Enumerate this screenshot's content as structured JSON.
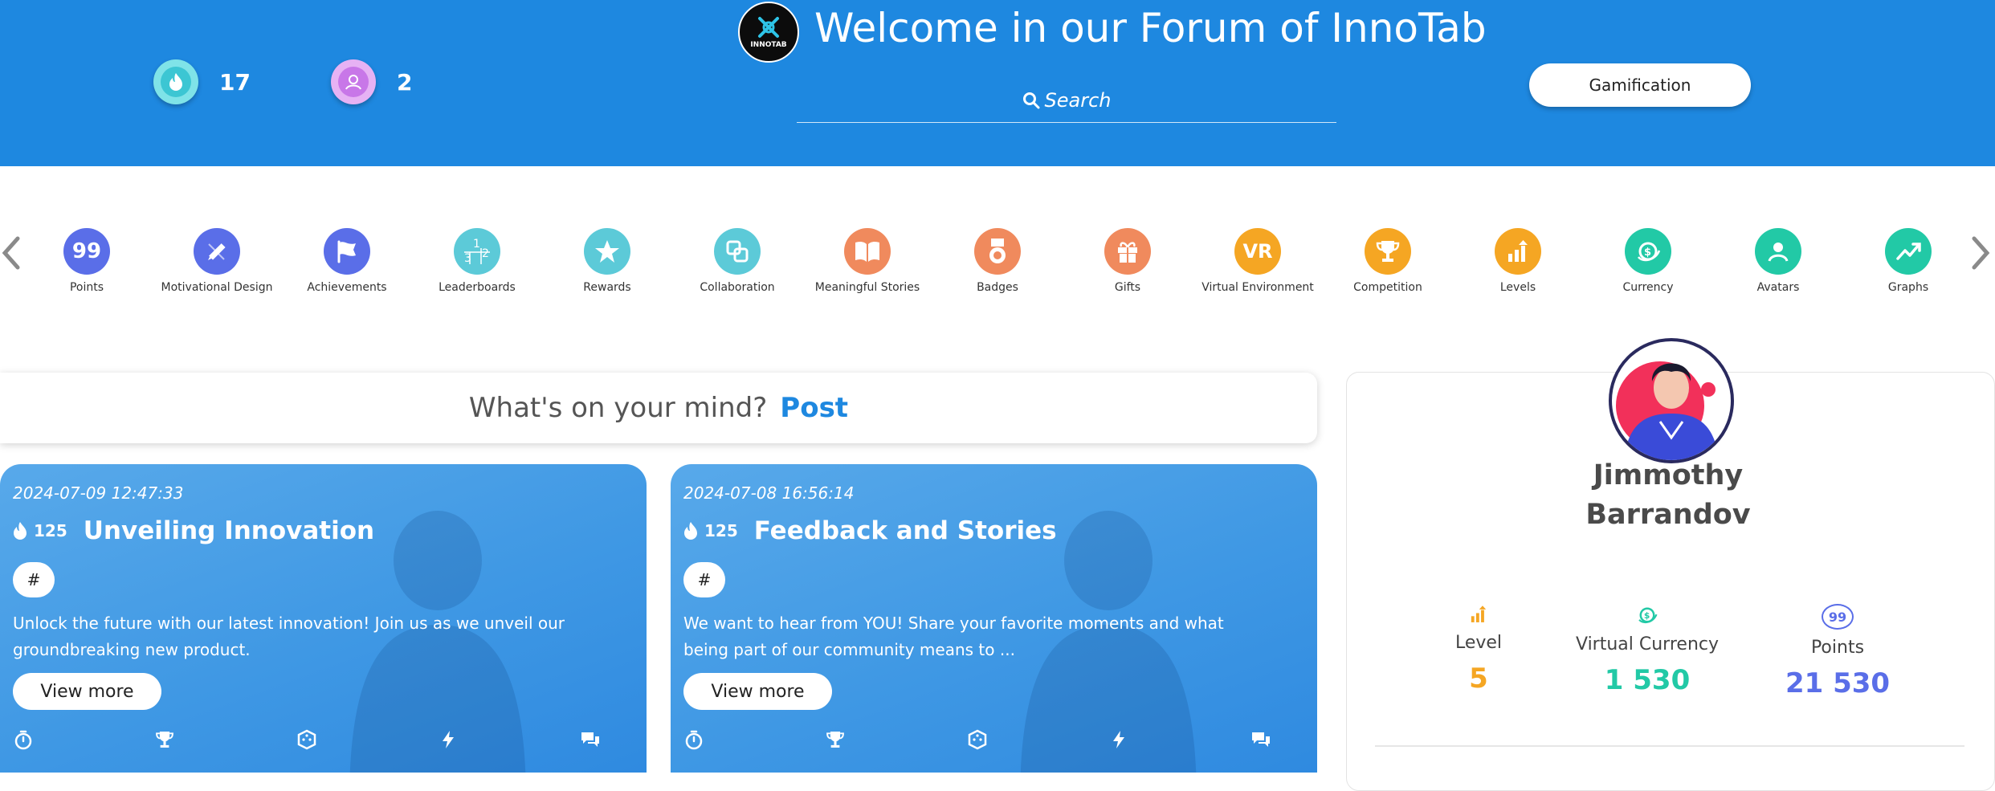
{
  "header": {
    "title": "Welcome in our Forum of InnoTab",
    "logo_text": "INNOTAB",
    "search_placeholder": "Search",
    "gamification_label": "Gamification",
    "stats": [
      {
        "icon": "flame-icon",
        "value": "17",
        "color": "#43d1d9"
      },
      {
        "icon": "user-badge-icon",
        "value": "2",
        "color": "#d78df0"
      }
    ]
  },
  "categories": [
    {
      "label": "Points",
      "icon": "points-99-icon",
      "color": "#5a6ee8",
      "text": "99"
    },
    {
      "label": "Motivational Design",
      "icon": "pencil-ruler-icon",
      "color": "#5a6ee8"
    },
    {
      "label": "Achievements",
      "icon": "flag-icon",
      "color": "#5a6ee8"
    },
    {
      "label": "Leaderboards",
      "icon": "ranking-icon",
      "color": "#5ccad8"
    },
    {
      "label": "Rewards",
      "icon": "star-icon",
      "color": "#5ccad8"
    },
    {
      "label": "Collaboration",
      "icon": "collaboration-icon",
      "color": "#5ccad8"
    },
    {
      "label": "Meaningful Stories",
      "icon": "book-icon",
      "color": "#f08a5d"
    },
    {
      "label": "Badges",
      "icon": "badge-icon",
      "color": "#f08a5d"
    },
    {
      "label": "Gifts",
      "icon": "gift-icon",
      "color": "#f08a5d"
    },
    {
      "label": "Virtual Environment",
      "icon": "vr-icon",
      "color": "#f5a623",
      "text": "VR"
    },
    {
      "label": "Competition",
      "icon": "trophy-icon",
      "color": "#f5a623"
    },
    {
      "label": "Levels",
      "icon": "levels-icon",
      "color": "#f5a623"
    },
    {
      "label": "Currency",
      "icon": "currency-icon",
      "color": "#22c9a6"
    },
    {
      "label": "Avatars",
      "icon": "avatar-icon",
      "color": "#22c9a6"
    },
    {
      "label": "Graphs",
      "icon": "graph-icon",
      "color": "#22c9a6"
    }
  ],
  "composer": {
    "prompt": "What's on your mind?",
    "action": "Post"
  },
  "posts": [
    {
      "date": "2024-07-09 12:47:33",
      "likes": "125",
      "title": "Unveiling Innovation",
      "tag": "#",
      "description": "Unlock the future with our latest innovation! Join us as we unveil our groundbreaking new product.",
      "button": "View more"
    },
    {
      "date": "2024-07-08 16:56:14",
      "likes": "125",
      "title": "Feedback and Stories",
      "tag": "#",
      "description": "We want to hear from YOU! Share your favorite moments and what being part of our community means to ...",
      "button": "View more"
    }
  ],
  "profile": {
    "name_first": "Jimmothy",
    "name_last": "Barrandov",
    "stats": [
      {
        "label": "Level",
        "value": "5",
        "color": "#f5a623",
        "icon": "levels-icon"
      },
      {
        "label": "Virtual Currency",
        "value": "1 530",
        "color": "#22c9a6",
        "icon": "currency-icon"
      },
      {
        "label": "Points",
        "value": "21 530",
        "color": "#5a6ee8",
        "icon": "points-99-icon",
        "icon_text": "99"
      }
    ]
  },
  "colors": {
    "header_bg": "#1e88e0",
    "accent": "#1e88e0"
  }
}
